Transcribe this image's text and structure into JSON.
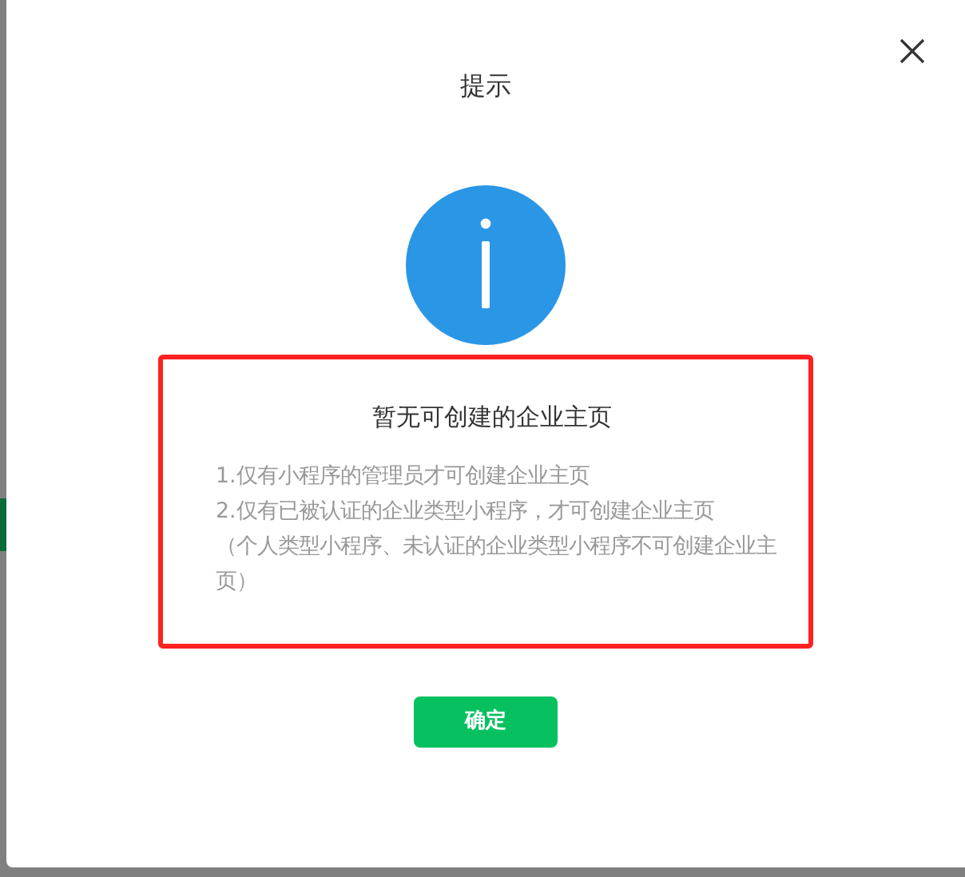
{
  "dialog": {
    "title": "提示"
  },
  "message": {
    "highlighted": true,
    "heading": "暂无可创建的企业主页",
    "lines": [
      "1.仅有小程序的管理员才可创建企业主页",
      "2.仅有已被认证的企业类型小程序，才可创建企业主页",
      "（个人类型小程序、未认证的企业类型小程序不可创建企业主页）"
    ]
  },
  "buttons": [
    "确定"
  ]
}
